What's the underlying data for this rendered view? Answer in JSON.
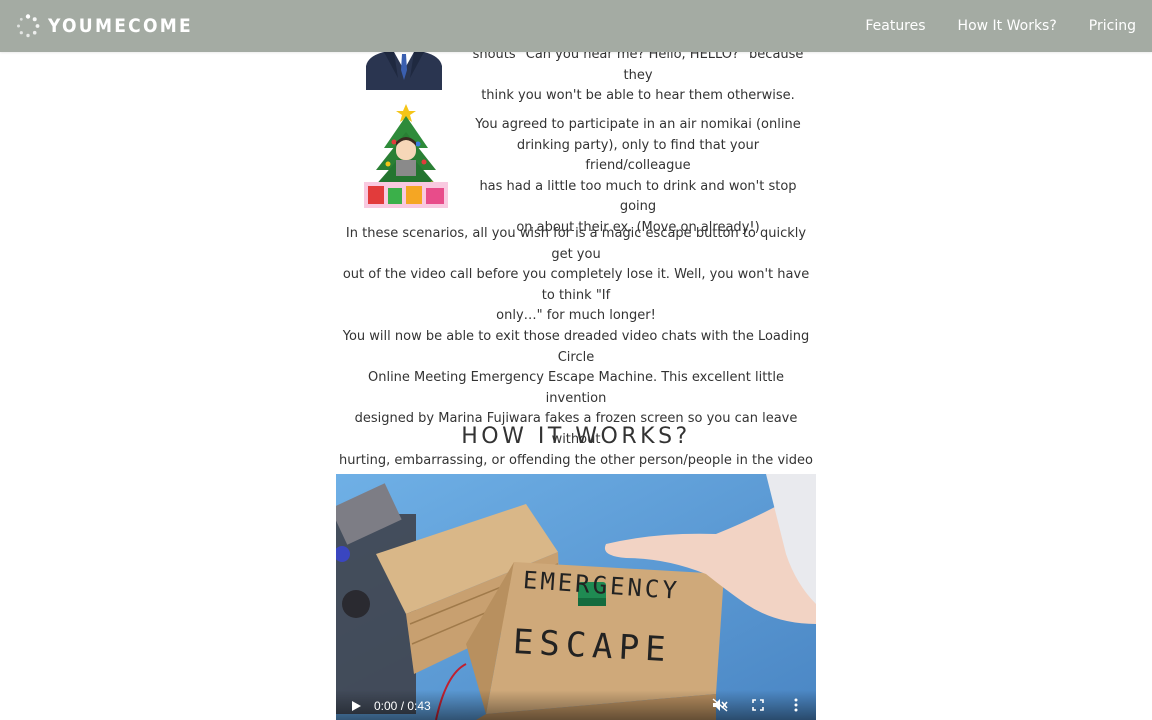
{
  "brand": {
    "name": "YOUMECOME",
    "logo_icon": "loading-circle-icon"
  },
  "nav": {
    "links": [
      "Features",
      "How It Works?",
      "Pricing"
    ]
  },
  "scenarios": [
    {
      "icon": "businessman-illustration",
      "lines": [
        "shouts \"Can you hear me? Hello, HELLO?\" because they",
        "think you won't be able to hear them otherwise."
      ]
    },
    {
      "icon": "christmas-tree-illustration",
      "lines": [
        "You agreed to participate in an air nomikai (online",
        "drinking party), only to find that your friend/colleague",
        "has had a little too much to drink and won't stop going",
        "on about their ex. (Move on already!)"
      ]
    }
  ],
  "paragraphs": [
    [
      "In these scenarios, all you wish for is a magic escape button to quickly get you",
      "out of the video call before you completely lose it. Well, you won't have to think \"If",
      "only…\" for much longer!"
    ],
    [
      "You will now be able to exit those dreaded video chats with the Loading Circle",
      "Online Meeting Emergency Escape Machine. This excellent little invention",
      "designed by Marina Fujiwara fakes a frozen screen so you can leave without",
      "hurting, embarrassing, or offending the other person/people in the video chat."
    ]
  ],
  "how_it_works": {
    "title": "HOW IT WORKS?",
    "video": {
      "box_text_1": "EMERGENCY",
      "box_text_2": "ESCAPE",
      "time": "0:00 / 0:43",
      "progress": 0
    }
  },
  "colors": {
    "navbar": "#a4aba3",
    "text": "#333333",
    "video_bg": "#5a92c8"
  }
}
